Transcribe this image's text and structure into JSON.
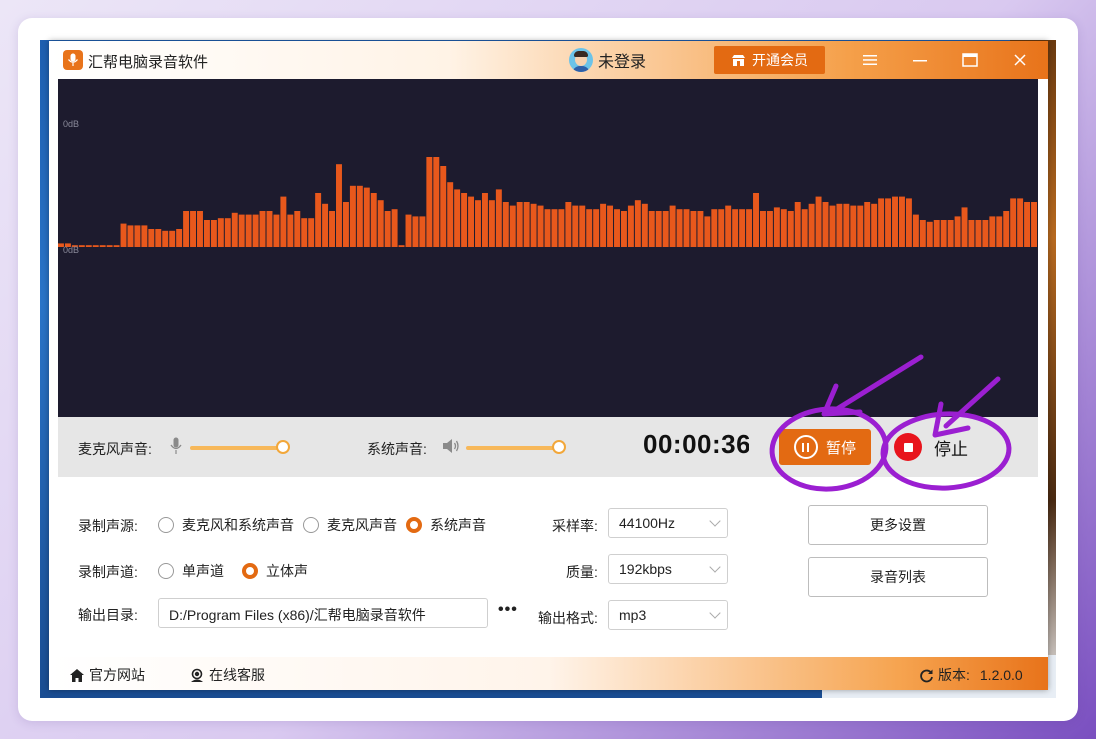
{
  "app": {
    "title": "汇帮电脑录音软件",
    "user_label": "未登录",
    "vip_label": "开通会员",
    "window_controls": [
      "menu-icon",
      "minimize-icon",
      "maximize-icon",
      "close-icon"
    ]
  },
  "visualizer": {
    "top_label": "0dB",
    "mid_label": "0dB",
    "bar_color": "#e8581c",
    "background": "#1d1b2e",
    "levels": [
      0.02,
      0.02,
      0.01,
      0.01,
      0.01,
      0.01,
      0.01,
      0.01,
      0.01,
      0.13,
      0.12,
      0.12,
      0.12,
      0.1,
      0.1,
      0.09,
      0.09,
      0.1,
      0.2,
      0.2,
      0.2,
      0.15,
      0.15,
      0.16,
      0.16,
      0.19,
      0.18,
      0.18,
      0.18,
      0.2,
      0.2,
      0.18,
      0.28,
      0.18,
      0.2,
      0.16,
      0.16,
      0.3,
      0.24,
      0.2,
      0.46,
      0.25,
      0.34,
      0.34,
      0.33,
      0.3,
      0.26,
      0.2,
      0.21,
      0.01,
      0.18,
      0.17,
      0.17,
      0.5,
      0.5,
      0.45,
      0.36,
      0.32,
      0.3,
      0.28,
      0.26,
      0.3,
      0.26,
      0.32,
      0.25,
      0.23,
      0.25,
      0.25,
      0.24,
      0.23,
      0.21,
      0.21,
      0.21,
      0.25,
      0.23,
      0.23,
      0.21,
      0.21,
      0.24,
      0.23,
      0.21,
      0.2,
      0.23,
      0.26,
      0.24,
      0.2,
      0.2,
      0.2,
      0.23,
      0.21,
      0.21,
      0.2,
      0.2,
      0.17,
      0.21,
      0.21,
      0.23,
      0.21,
      0.21,
      0.21,
      0.3,
      0.2,
      0.2,
      0.22,
      0.21,
      0.2,
      0.25,
      0.21,
      0.24,
      0.28,
      0.25,
      0.23,
      0.24,
      0.24,
      0.23,
      0.23,
      0.25,
      0.24,
      0.27,
      0.27,
      0.28,
      0.28,
      0.27,
      0.18,
      0.15,
      0.14,
      0.15,
      0.15,
      0.15,
      0.17,
      0.22,
      0.15,
      0.15,
      0.15,
      0.17,
      0.17,
      0.2,
      0.27,
      0.27,
      0.25,
      0.25
    ]
  },
  "controls": {
    "mic_label": "麦克风声音:",
    "mic_level": 1.0,
    "system_label": "系统声音:",
    "system_level": 1.0,
    "timer": "00:00:36",
    "pause_label": "暂停",
    "stop_label": "停止",
    "accent_color": "#e36a12",
    "stop_color": "#e8141c"
  },
  "settings": {
    "source_label": "录制声源:",
    "source_options": [
      "麦克风和系统声音",
      "麦克风声音",
      "系统声音"
    ],
    "source_selected": 2,
    "channel_label": "录制声道:",
    "channel_options": [
      "单声道",
      "立体声"
    ],
    "channel_selected": 1,
    "output_label": "输出目录:",
    "output_path": "D:/Program Files (x86)/汇帮电脑录音软件",
    "output_more": "•••",
    "sample_rate_label": "采样率:",
    "sample_rate_value": "44100Hz",
    "quality_label": "质量:",
    "quality_value": "192kbps",
    "format_label": "输出格式:",
    "format_value": "mp3",
    "more_settings_label": "更多设置",
    "record_list_label": "录音列表"
  },
  "footer": {
    "website_label": "官方网站",
    "support_label": "在线客服",
    "version_label": "版本:",
    "version_value": "1.2.0.0"
  },
  "annotations": {
    "color": "#9b1fd1",
    "targets": [
      "pause-button",
      "stop-button"
    ]
  }
}
